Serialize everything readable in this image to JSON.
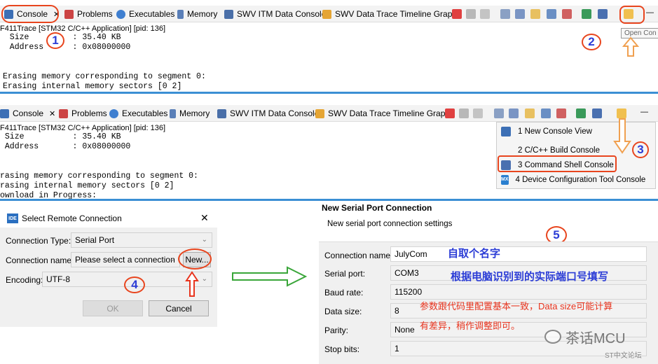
{
  "top_panel": {
    "tabs": [
      {
        "label": "Console"
      },
      {
        "label": "Problems"
      },
      {
        "label": "Executables"
      },
      {
        "label": "Memory"
      },
      {
        "label": "SWV ITM Data Console"
      },
      {
        "label": "SWV Data Trace Timeline Graph"
      }
    ],
    "close_glyph": "✕",
    "minimize_glyph": "—",
    "app_line": "F411Trace [STM32 C/C++ Application]  [pid: 136]",
    "console_lines": [
      "  Size         : 35.40 KB",
      "  Address      : 0x08000000",
      "",
      "",
      "Erasing memory corresponding to segment 0:",
      "Erasing internal memory sectors [0 2]"
    ],
    "tooltip": "Open Con",
    "markers": [
      "1",
      "2"
    ]
  },
  "mid_panel": {
    "tabs": [
      {
        "label": "Console"
      },
      {
        "label": "Problems"
      },
      {
        "label": "Executables"
      },
      {
        "label": "Memory"
      },
      {
        "label": "SWV ITM Data Console"
      },
      {
        "label": "SWV Data Trace Timeline Graph"
      }
    ],
    "close_glyph": "✕",
    "minimize_glyph": "—",
    "app_line": "F411Trace [STM32 C/C++ Application]  [pid: 136]",
    "console_lines": [
      " Size          : 35.40 KB",
      " Address       : 0x08000000",
      "",
      "",
      "rasing memory corresponding to segment 0:",
      "rasing internal memory sectors [0 2]",
      "ownload in Progress:"
    ],
    "menu": [
      {
        "label": "1 New Console View",
        "icon": "console-view-icon"
      },
      {
        "label": "2 C/C++ Build Console",
        "icon": ""
      },
      {
        "label": "3 Command Shell Console",
        "icon": "command-shell-icon"
      },
      {
        "label": "4 Device Configuration Tool Console",
        "icon": "mx-icon",
        "icon_text": "MX"
      }
    ],
    "marker": "3"
  },
  "dialog": {
    "title": "Select Remote Connection",
    "icon_text": "IDE",
    "close_glyph": "✕",
    "connection_type_label": "Connection Type:",
    "connection_type_value": "Serial Port",
    "connection_name_label": "Connection name:",
    "connection_name_value": "Please select a connection",
    "new_button": "New...",
    "encoding_label": "Encoding:",
    "encoding_value": "UTF-8",
    "ok_button": "OK",
    "cancel_button": "Cancel",
    "marker": "4"
  },
  "serial": {
    "title": "New Serial Port Connection",
    "subtitle": "New serial port connection settings",
    "marker": "5",
    "fields": [
      {
        "label": "Connection name:",
        "value": "JulyCom"
      },
      {
        "label": "Serial port:",
        "value": "COM3"
      },
      {
        "label": "Baud rate:",
        "value": "115200"
      },
      {
        "label": "Data size:",
        "value": "8"
      },
      {
        "label": "Parity:",
        "value": "None"
      },
      {
        "label": "Stop bits:",
        "value": "1"
      }
    ],
    "note_name": "自取个名字",
    "note_port": "根据电脑识别到的实际端口号填写",
    "note_line1": "参数跟代码里配置基本一致，Data size可能计算",
    "note_line2": "有差异，稍作调整即可。",
    "watermark_main": "茶话MCU",
    "watermark_sub": "ST中文论坛"
  },
  "colors": {
    "annotation": "#e8451e",
    "marker_text": "#2b3cd6",
    "separator": "#3b8fd4",
    "arrow": "#3aa63a",
    "orange_arrow": "#f0a050"
  }
}
